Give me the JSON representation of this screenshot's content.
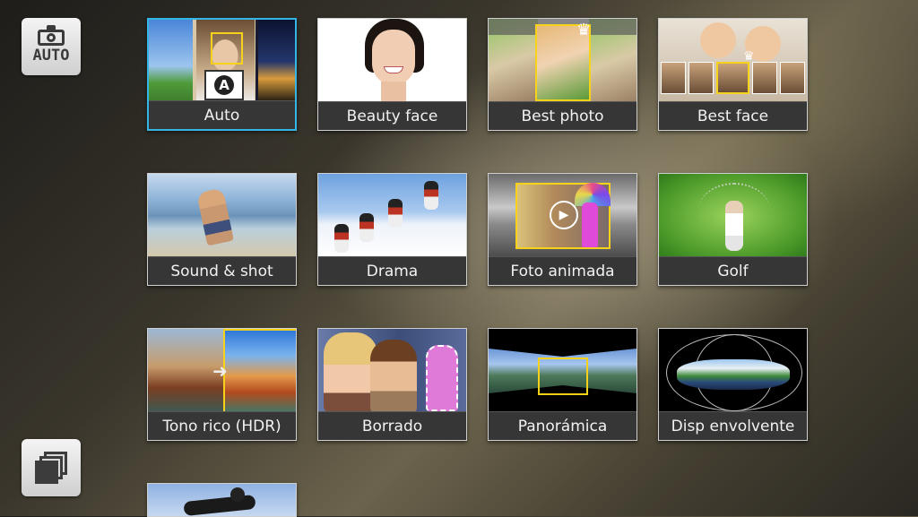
{
  "mode_button": {
    "label": "AUTO",
    "icon": "camera-auto-icon"
  },
  "gallery_button": {
    "icon": "gallery-stack-icon"
  },
  "modes": [
    {
      "id": "auto",
      "label": "Auto",
      "selected": true
    },
    {
      "id": "beauty",
      "label": "Beauty face",
      "selected": false
    },
    {
      "id": "bestphoto",
      "label": "Best photo",
      "selected": false
    },
    {
      "id": "bestface",
      "label": "Best face",
      "selected": false
    },
    {
      "id": "sound",
      "label": "Sound & shot",
      "selected": false
    },
    {
      "id": "drama",
      "label": "Drama",
      "selected": false
    },
    {
      "id": "foto",
      "label": "Foto animada",
      "selected": false
    },
    {
      "id": "golf",
      "label": "Golf",
      "selected": false
    },
    {
      "id": "hdr",
      "label": "Tono rico (HDR)",
      "selected": false
    },
    {
      "id": "borrado",
      "label": "Borrado",
      "selected": false
    },
    {
      "id": "pano",
      "label": "Panorámica",
      "selected": false
    },
    {
      "id": "disp",
      "label": "Disp envolvente",
      "selected": false
    }
  ],
  "colors": {
    "selection": "#33b5e5",
    "highlight_frame": "#f7d21a"
  }
}
